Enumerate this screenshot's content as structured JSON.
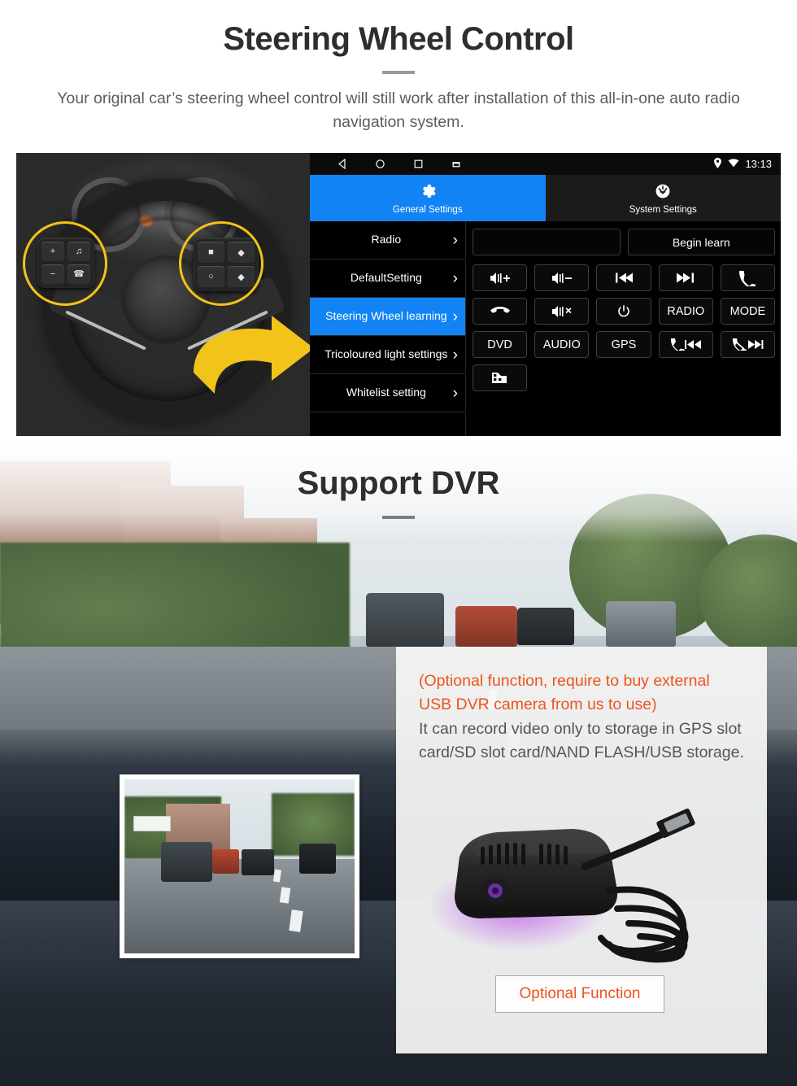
{
  "section_steering": {
    "title": "Steering Wheel Control",
    "subtitle": "Your original car’s steering wheel control will still work after installation of this all-in-one auto radio navigation system."
  },
  "android_unit": {
    "statusbar": {
      "nav_icons": [
        "back-icon",
        "home-icon",
        "recents-icon",
        "screenshot-icon"
      ],
      "location_icon": "location-pin-icon",
      "wifi_icon": "wifi-icon",
      "time": "13:13"
    },
    "tabs": [
      {
        "label": "General Settings",
        "icon": "gear-icon",
        "active": true
      },
      {
        "label": "System Settings",
        "icon": "system-logo-icon",
        "active": false
      }
    ],
    "menu_items": [
      {
        "label": "Radio",
        "selected": false
      },
      {
        "label": "DefaultSetting",
        "selected": false
      },
      {
        "label": "Steering Wheel learning",
        "selected": true
      },
      {
        "label": "Tricoloured light settings",
        "selected": false
      },
      {
        "label": "Whitelist setting",
        "selected": false
      }
    ],
    "learn_field_value": "",
    "begin_learn_label": "Begin learn",
    "key_buttons": [
      {
        "name": "volume-up-key",
        "icon": "speaker-plus-icon",
        "label": ""
      },
      {
        "name": "volume-down-key",
        "icon": "speaker-minus-icon",
        "label": ""
      },
      {
        "name": "previous-track-key",
        "icon": "previous-icon",
        "label": ""
      },
      {
        "name": "next-track-key",
        "icon": "next-icon",
        "label": ""
      },
      {
        "name": "answer-call-key",
        "icon": "phone-icon",
        "label": ""
      },
      {
        "name": "end-call-key",
        "icon": "hangup-icon",
        "label": ""
      },
      {
        "name": "mute-key",
        "icon": "speaker-mute-icon",
        "label": ""
      },
      {
        "name": "power-key",
        "icon": "power-icon",
        "label": ""
      },
      {
        "name": "radio-key",
        "icon": "",
        "label": "RADIO"
      },
      {
        "name": "mode-key",
        "icon": "",
        "label": "MODE"
      },
      {
        "name": "dvd-key",
        "icon": "",
        "label": "DVD"
      },
      {
        "name": "audio-key",
        "icon": "",
        "label": "AUDIO"
      },
      {
        "name": "gps-key",
        "icon": "",
        "label": "GPS"
      },
      {
        "name": "phone-previous-key",
        "icon": "phone-previous-icon",
        "label": ""
      },
      {
        "name": "phone-next-key",
        "icon": "phone-next-icon",
        "label": ""
      },
      {
        "name": "car-key",
        "icon": "car-icon",
        "label": ""
      }
    ],
    "accent_color": "#1283F5",
    "highlight_color": "#F2C318"
  },
  "section_dvr": {
    "title": "Support DVR",
    "note_optional": "(Optional function, require to buy external USB DVR camera from us to use)",
    "note_detail": "It can record video only to storage in GPS slot card/SD slot card/NAND FLASH/USB storage.",
    "button_label": "Optional Function",
    "button_color": "#F0531C"
  }
}
